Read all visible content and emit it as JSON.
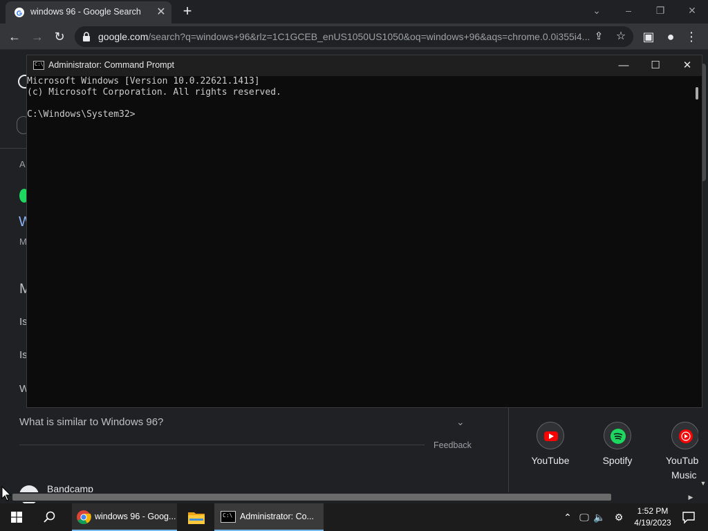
{
  "browser": {
    "tab_title": "windows 96 - Google Search",
    "url_domain": "google.com",
    "url_rest": "/search?q=windows+96&rlz=1C1GCEB_enUS1050US1050&oq=windows+96&aqs=chrome.0.0i355i4..."
  },
  "page": {
    "fragments": [
      "A",
      "W",
      "M",
      "M",
      "Is",
      "Is",
      "W"
    ],
    "faq_question": "What is similar to Windows 96?",
    "feedback": "Feedback",
    "services": [
      {
        "label": "YouTube",
        "color": "#ff0000"
      },
      {
        "label": "Spotify",
        "color": "#1ed760"
      },
      {
        "label": "YouTube Music",
        "color": "#ff0000"
      }
    ],
    "service_line1": [
      "YouTube",
      "Spotify",
      "YouTub"
    ],
    "service_line2": "Music",
    "bandcamp": "Bandcamp"
  },
  "cmd": {
    "title": "Administrator: Command Prompt",
    "lines": [
      "Microsoft Windows [Version 10.0.22621.1413]",
      "(c) Microsoft Corporation. All rights reserved.",
      "",
      "C:\\Windows\\System32>"
    ]
  },
  "taskbar": {
    "chrome_label": "windows 96 - Goog...",
    "cmd_label": "Administrator:  Co...",
    "time": "1:52 PM",
    "date": "4/19/2023"
  }
}
